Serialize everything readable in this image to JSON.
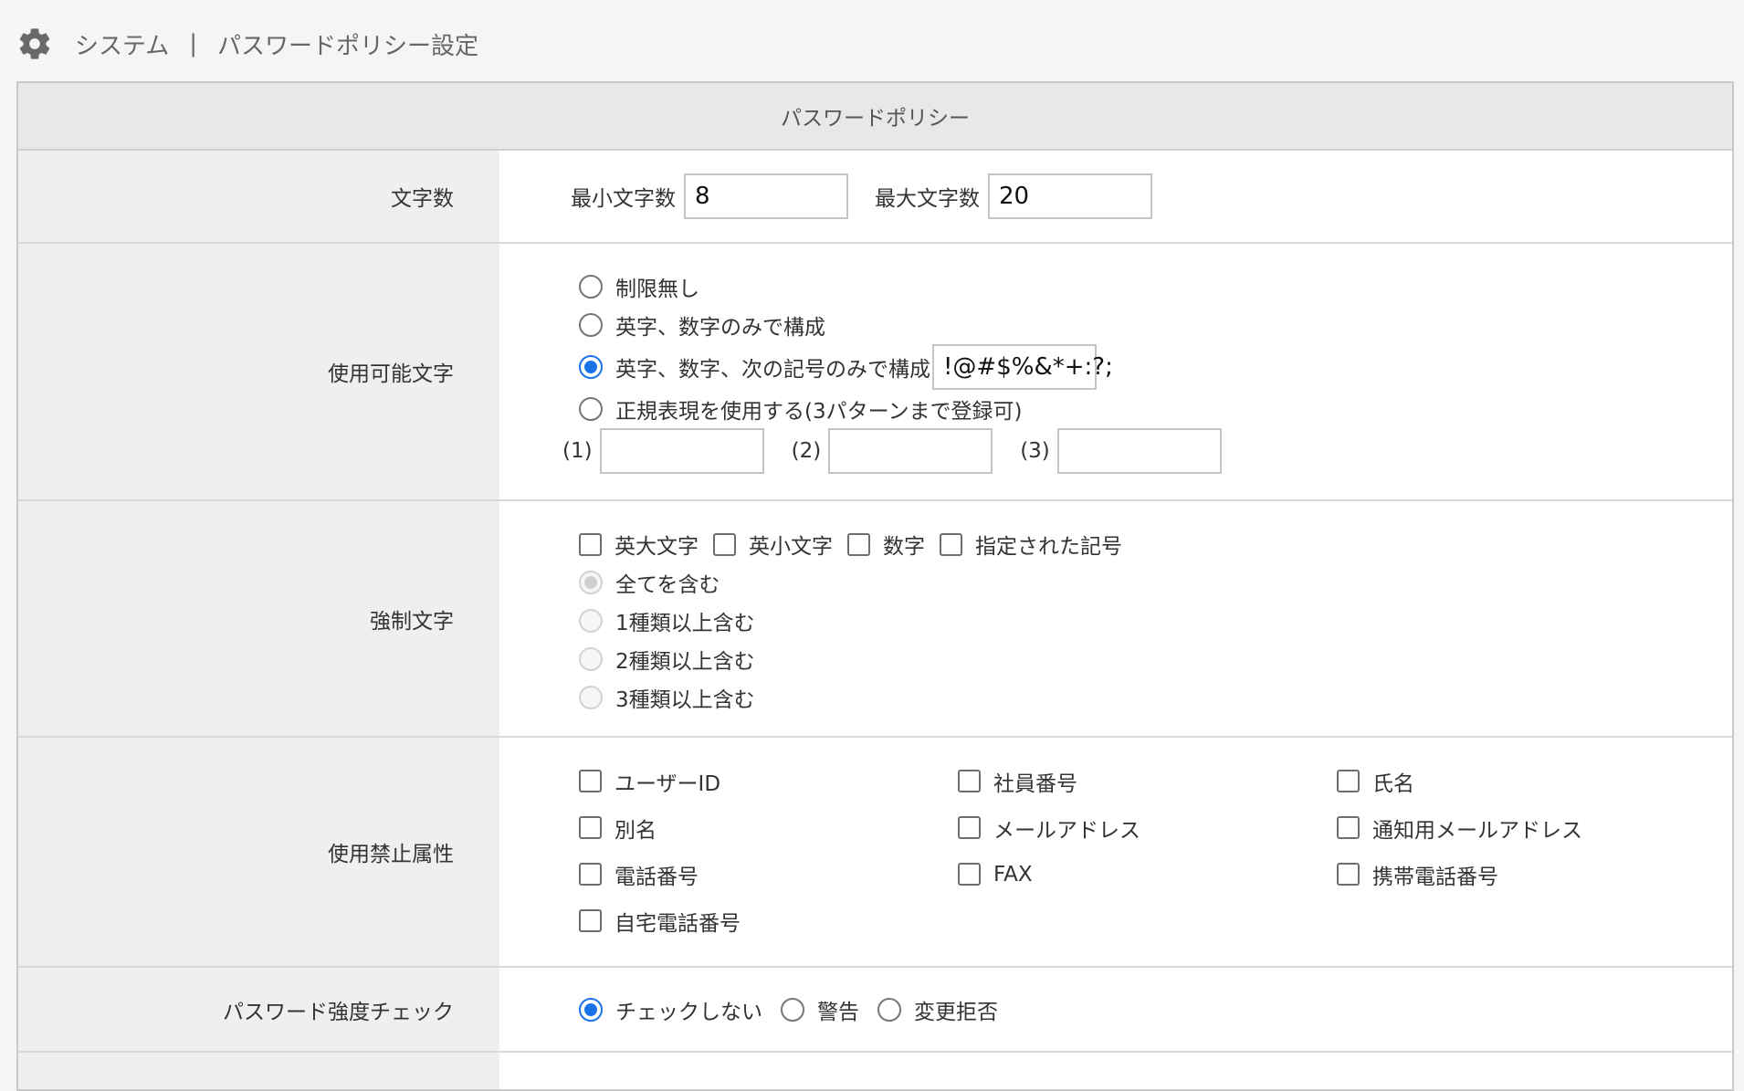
{
  "header": {
    "section": "システム",
    "separator": "|",
    "title": "パスワードポリシー設定"
  },
  "panel": {
    "title": "パスワードポリシー"
  },
  "length": {
    "label": "文字数",
    "min_label": "最小文字数",
    "min_value": "8",
    "max_label": "最大文字数",
    "max_value": "20"
  },
  "allowed": {
    "label": "使用可能文字",
    "options": [
      "制限無し",
      "英字、数字のみで構成",
      "英字、数字、次の記号のみで構成",
      "正規表現を使用する(3パターンまで登録可)"
    ],
    "selected_index": 2,
    "symbols_value": "!@#$%&*+:?;",
    "regex_labels": [
      "(1)",
      "(2)",
      "(3)"
    ],
    "regex_values": [
      "",
      "",
      ""
    ]
  },
  "required": {
    "label": "強制文字",
    "types": [
      "英大文字",
      "英小文字",
      "数字",
      "指定された記号"
    ],
    "rules": [
      "全てを含む",
      "1種類以上含む",
      "2種類以上含む",
      "3種類以上含む"
    ],
    "selected_rule_index": 0
  },
  "forbidden": {
    "label": "使用禁止属性",
    "items": [
      "ユーザーID",
      "社員番号",
      "氏名",
      "別名",
      "メールアドレス",
      "通知用メールアドレス",
      "電話番号",
      "FAX",
      "携帯電話番号",
      "自宅電話番号"
    ]
  },
  "strength": {
    "label": "パスワード強度チェック",
    "options": [
      "チェックしない",
      "警告",
      "変更拒否"
    ],
    "selected_index": 0
  },
  "colors": {
    "accent": "#1a73e8",
    "label_bg": "#efefef",
    "title_bg": "#e8e8e8"
  }
}
